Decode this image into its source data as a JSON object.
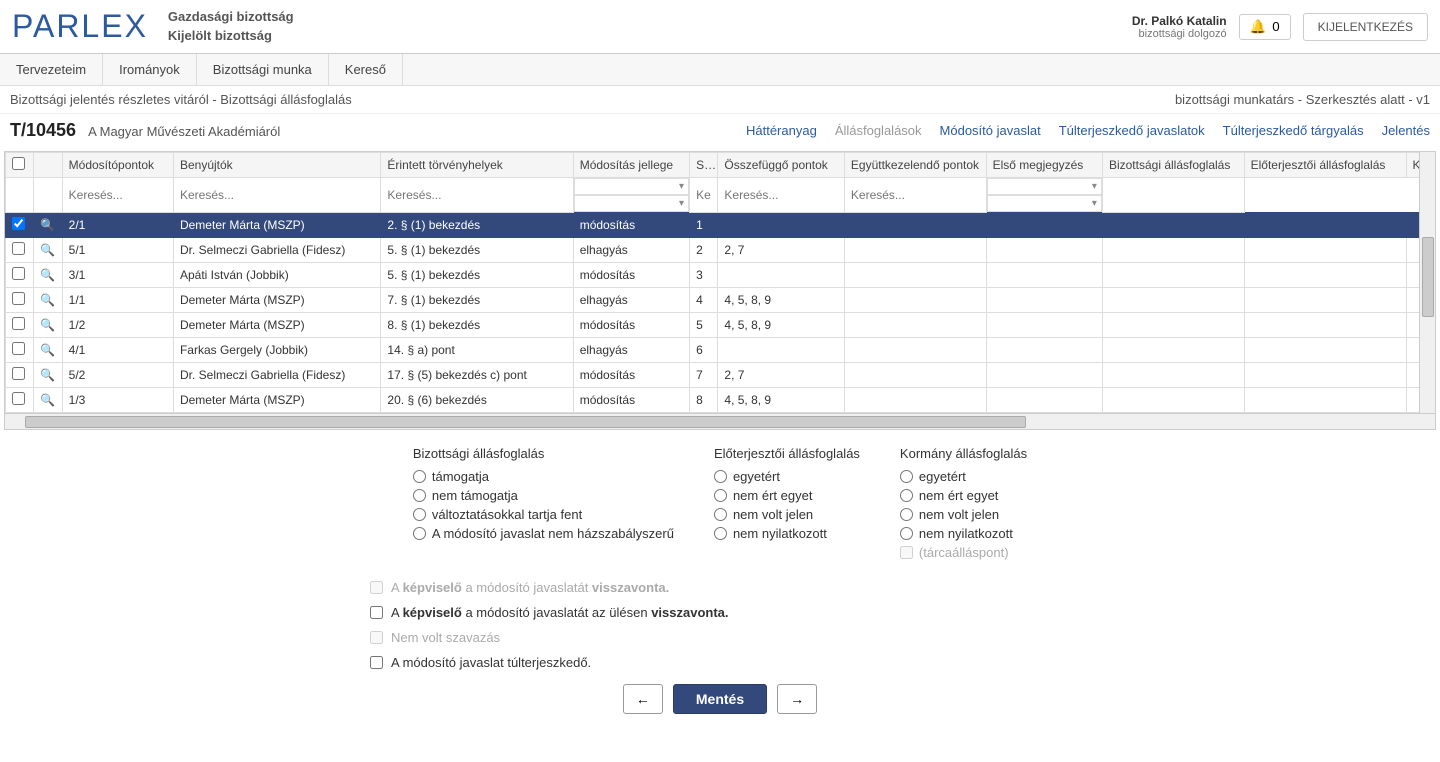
{
  "header": {
    "logo": "PARLEX",
    "title1": "Gazdasági bizottság",
    "title2": "Kijelölt bizottság",
    "user_name": "Dr. Palkó Katalin",
    "user_role": "bizottsági dolgozó",
    "notif_count": "0",
    "logout": "KIJELENTKEZÉS"
  },
  "nav": {
    "items": [
      "Tervezeteim",
      "Irományok",
      "Bizottsági munka",
      "Kereső"
    ]
  },
  "breadcrumb": "Bizottsági jelentés részletes vitáról - Bizottsági állásfoglalás",
  "context_right": "bizottsági munkatárs - Szerkesztés alatt - v1",
  "doc": {
    "id": "T/10456",
    "title": "A Magyar Művészeti Akadémiáról"
  },
  "tabs": [
    "Háttéranyag",
    "Állásfoglalások",
    "Módosító javaslat",
    "Túlterjeszkedő javaslatok",
    "Túlterjeszkedő tárgyalás",
    "Jelentés"
  ],
  "active_tab_index": 1,
  "columns": {
    "mp": "Módosítópontok",
    "ben": "Benyújtók",
    "erv": "Érintett törvényhelyek",
    "jel": "Módosítás jellege",
    "s": "S",
    "ossz": "Összefüggő pontok",
    "egy": "Együttkezelendő pontok",
    "elso": "Első megjegyzés",
    "biz": "Bizottsági állásfoglalás",
    "elo": "Előterjesztői állásfoglalás",
    "ko": "Ko"
  },
  "search_ph": "Keresés...",
  "rows": [
    {
      "sel": true,
      "mp": "2/1",
      "ben": "Demeter Márta (MSZP)",
      "erv": "2. § (1) bekezdés",
      "jel": "módosítás",
      "s": "1",
      "ossz": ""
    },
    {
      "sel": false,
      "mp": "5/1",
      "ben": "Dr. Selmeczi Gabriella (Fidesz)",
      "erv": "5. § (1) bekezdés",
      "jel": "elhagyás",
      "s": "2",
      "ossz": "2, 7"
    },
    {
      "sel": false,
      "mp": "3/1",
      "ben": "Apáti István (Jobbik)",
      "erv": "5. § (1) bekezdés",
      "jel": "módosítás",
      "s": "3",
      "ossz": ""
    },
    {
      "sel": false,
      "mp": "1/1",
      "ben": "Demeter Márta (MSZP)",
      "erv": "7. § (1) bekezdés",
      "jel": "elhagyás",
      "s": "4",
      "ossz": "4, 5, 8, 9"
    },
    {
      "sel": false,
      "mp": "1/2",
      "ben": "Demeter Márta (MSZP)",
      "erv": "8. § (1) bekezdés",
      "jel": "módosítás",
      "s": "5",
      "ossz": "4, 5, 8, 9"
    },
    {
      "sel": false,
      "mp": "4/1",
      "ben": "Farkas Gergely (Jobbik)",
      "erv": "14. § a) pont",
      "jel": "elhagyás",
      "s": "6",
      "ossz": ""
    },
    {
      "sel": false,
      "mp": "5/2",
      "ben": "Dr. Selmeczi Gabriella (Fidesz)",
      "erv": "17. § (5) bekezdés c) pont",
      "jel": "módosítás",
      "s": "7",
      "ossz": "2, 7"
    },
    {
      "sel": false,
      "mp": "1/3",
      "ben": "Demeter Márta (MSZP)",
      "erv": "20. § (6) bekezdés",
      "jel": "módosítás",
      "s": "8",
      "ossz": "4, 5, 8, 9"
    }
  ],
  "form": {
    "col1_title": "Bizottsági állásfoglalás",
    "col1_opts": [
      "támogatja",
      "nem támogatja",
      "változtatásokkal tartja fent",
      "A módosító javaslat nem házszabályszerű"
    ],
    "col2_title": "Előterjesztői állásfoglalás",
    "col2_opts": [
      "egyetért",
      "nem ért egyet",
      "nem volt jelen",
      "nem nyilatkozott"
    ],
    "col3_title": "Kormány állásfoglalás",
    "col3_opts": [
      "egyetért",
      "nem ért egyet",
      "nem volt jelen",
      "nem nyilatkozott"
    ],
    "col3_extra": "(tárcaálláspont)",
    "chk1_pre": "A ",
    "chk1_b1": "képviselő",
    "chk1_mid": " a módosító javaslatát ",
    "chk1_b2": "visszavonta.",
    "chk2_pre": "A ",
    "chk2_b1": "képviselő",
    "chk2_mid": " a módosító javaslatát az ülésen ",
    "chk2_b2": "visszavonta.",
    "chk3": "Nem volt szavazás",
    "chk4": "A módosító javaslat túlterjeszkedő.",
    "prev": "←",
    "save": "Mentés",
    "next": "→"
  }
}
